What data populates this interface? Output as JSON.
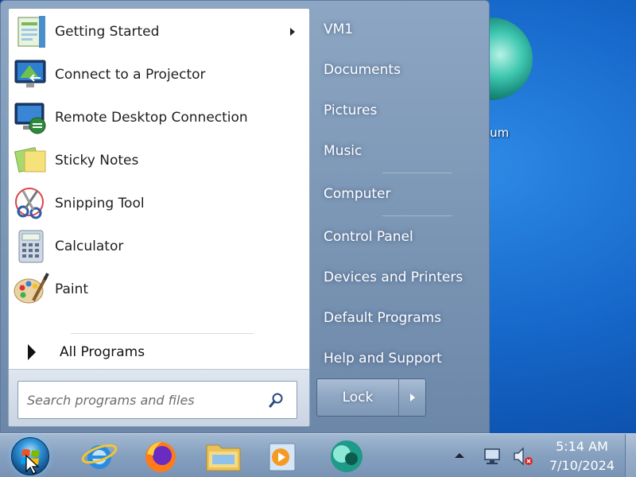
{
  "desktop": {
    "icon_label": "ium"
  },
  "start_menu": {
    "programs": [
      {
        "label": "Getting Started",
        "icon": "getting-started-icon",
        "has_submenu": true
      },
      {
        "label": "Connect to a Projector",
        "icon": "projector-icon"
      },
      {
        "label": "Remote Desktop Connection",
        "icon": "remote-desktop-icon"
      },
      {
        "label": "Sticky Notes",
        "icon": "sticky-notes-icon"
      },
      {
        "label": "Snipping Tool",
        "icon": "scissors-icon"
      },
      {
        "label": "Calculator",
        "icon": "calculator-icon"
      },
      {
        "label": "Paint",
        "icon": "paint-palette-icon"
      }
    ],
    "all_programs": "All Programs",
    "search": {
      "placeholder": "Search programs and files",
      "value": ""
    },
    "right_items": [
      "VM1",
      "Documents",
      "Pictures",
      "Music",
      "Computer",
      "Control Panel",
      "Devices and Printers",
      "Default Programs",
      "Help and Support"
    ],
    "lock_label": "Lock"
  },
  "taskbar": {
    "pinned": [
      {
        "name": "internet-explorer-icon"
      },
      {
        "name": "firefox-icon"
      },
      {
        "name": "file-explorer-icon"
      },
      {
        "name": "media-player-icon"
      },
      {
        "name": "teal-app-icon"
      }
    ],
    "clock": {
      "time": "5:14 AM",
      "date": "7/10/2024"
    }
  }
}
